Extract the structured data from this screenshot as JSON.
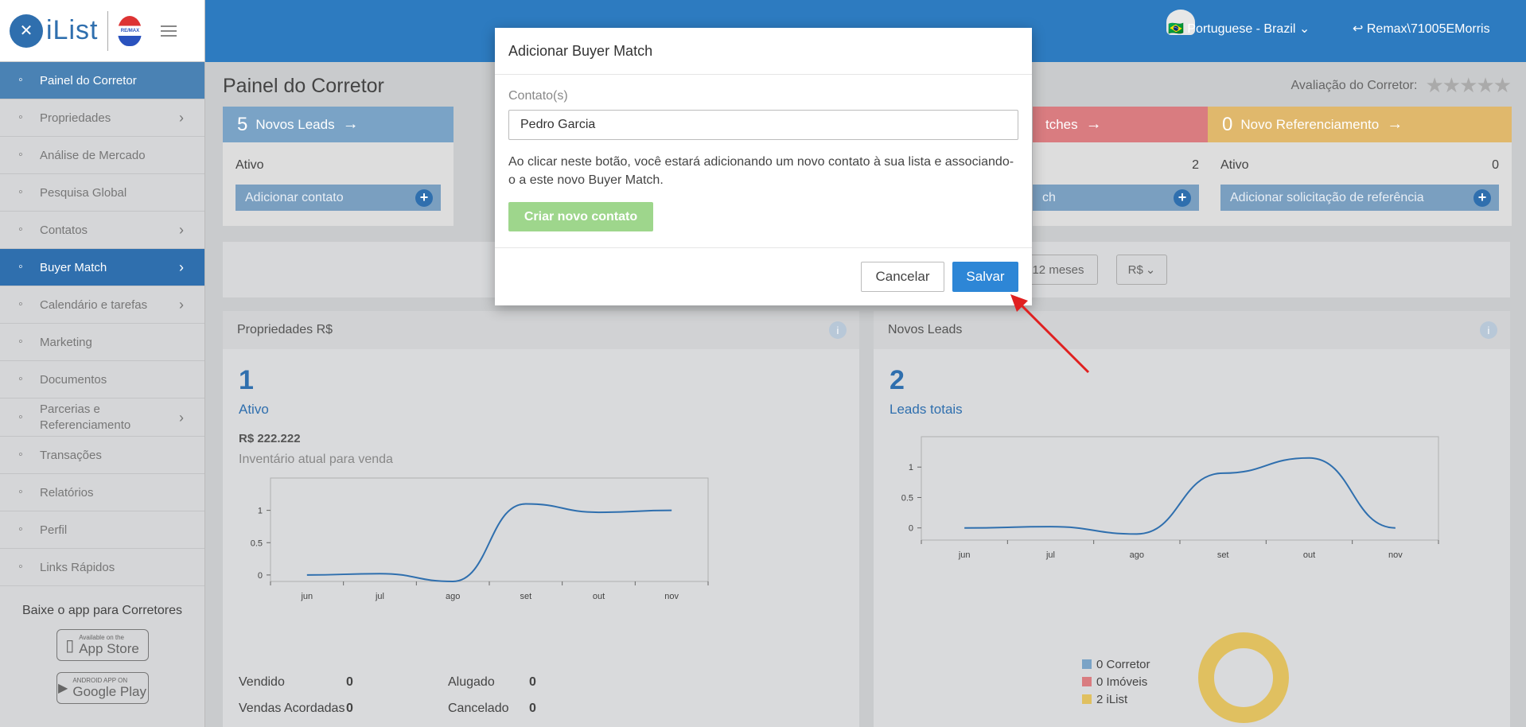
{
  "sidebar": {
    "logo_text": "iList",
    "brand_badge": "RE/MAX",
    "items": [
      {
        "label": "Painel do Corretor",
        "icon": "dashboard-icon",
        "active": true
      },
      {
        "label": "Propriedades",
        "icon": "home-icon",
        "chevron": true
      },
      {
        "label": "Análise de Mercado",
        "icon": "bar-chart-icon"
      },
      {
        "label": "Pesquisa Global",
        "icon": "search-icon"
      },
      {
        "label": "Contatos",
        "icon": "user-icon",
        "chevron": true
      },
      {
        "label": "Buyer Match",
        "icon": "fire-icon",
        "chevron": true,
        "selected": true
      },
      {
        "label": "Calendário e tarefas",
        "icon": "calendar-icon",
        "chevron": true
      },
      {
        "label": "Marketing",
        "icon": "book-icon"
      },
      {
        "label": "Documentos",
        "icon": "folder-icon"
      },
      {
        "label": "Parcerias e Referenciamento",
        "icon": "handshake-icon",
        "chevron": true
      },
      {
        "label": "Transações",
        "icon": "briefcase-icon"
      },
      {
        "label": "Relatórios",
        "icon": "report-icon"
      },
      {
        "label": "Perfil",
        "icon": "profile-icon"
      },
      {
        "label": "Links Rápidos",
        "icon": "links-icon"
      }
    ],
    "app_title": "Baixe o app para Corretores",
    "appstore_small": "Available on the",
    "appstore_big": "App Store",
    "play_small": "ANDROID APP ON",
    "play_big": "Google Play"
  },
  "topbar": {
    "language": "Portuguese - Brazil",
    "user": "Remax\\71005EMorris",
    "accent": "#2d7bc0"
  },
  "main": {
    "title": "Painel do Corretor",
    "rating_label": "Avaliação do Corretor:",
    "cards": [
      {
        "num": "5",
        "title": "Novos Leads",
        "row_label": "Ativo",
        "row_value": "",
        "button": "Adicionar contato",
        "color": "#7aa3c6"
      },
      {
        "num": "",
        "title": "tches",
        "row_label": "",
        "row_value": "2",
        "button": "ch",
        "color": "#d97c80"
      },
      {
        "num": "0",
        "title": "Novo Referenciamento",
        "row_label": "Ativo",
        "row_value": "0",
        "button": "Adicionar solicitação de referência",
        "color": "#e0b86c"
      }
    ],
    "filters": {
      "period": "12 meses",
      "currency": "R$"
    },
    "left_panel": {
      "title": "Propriedades  R$",
      "big": "1",
      "sub": "Ativo",
      "amount": "R$ 222.222",
      "amount_label": "Inventário atual para venda",
      "stats": [
        {
          "label": "Vendido",
          "value": "0"
        },
        {
          "label": "Alugado",
          "value": "0"
        },
        {
          "label": "Vendas Acordadas",
          "value": "0"
        },
        {
          "label": "Cancelado",
          "value": "0"
        }
      ]
    },
    "right_panel": {
      "title": "Novos Leads",
      "big": "2",
      "sub": "Leads totais",
      "legend": [
        {
          "label": "0 Corretor",
          "color": "#7aa3c6"
        },
        {
          "label": "0 Imóveis",
          "color": "#d97c80"
        },
        {
          "label": "2 iList",
          "color": "#e0c060"
        }
      ]
    }
  },
  "chart_data": [
    {
      "type": "line",
      "categories": [
        "jun",
        "jul",
        "ago",
        "set",
        "out",
        "nov"
      ],
      "values": [
        0,
        0.02,
        -0.1,
        1.1,
        0.97,
        1.0
      ],
      "yticks": [
        "0",
        "0.5",
        "1"
      ],
      "ylim": [
        -0.1,
        1.5
      ]
    },
    {
      "type": "line",
      "categories": [
        "jun",
        "jul",
        "ago",
        "set",
        "out",
        "nov"
      ],
      "values": [
        0,
        0.02,
        -0.1,
        0.9,
        1.15,
        0
      ],
      "yticks": [
        "0",
        "0.5",
        "1"
      ],
      "ylim": [
        -0.2,
        1.5
      ]
    }
  ],
  "modal": {
    "title": "Adicionar Buyer Match",
    "contact_label": "Contato(s)",
    "contact_value": "Pedro Garcia",
    "description": "Ao clicar neste botão, você estará adicionando um novo contato à sua lista e associando-o a este novo Buyer Match.",
    "create_button": "Criar novo contato",
    "cancel": "Cancelar",
    "save": "Salvar"
  }
}
